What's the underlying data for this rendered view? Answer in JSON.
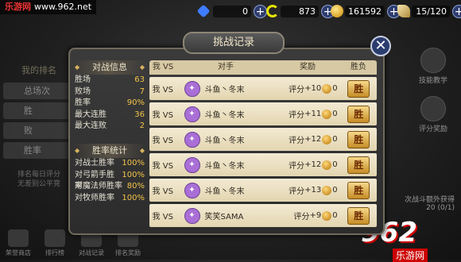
{
  "watermark": {
    "site": "乐游网",
    "url": "www.962.net"
  },
  "resources": [
    {
      "value": "0",
      "icon": "gem-icon",
      "color": "#3f7cff"
    },
    {
      "value": "873",
      "icon": "crescent-icon",
      "color": "#e6e600"
    },
    {
      "value": "161592",
      "icon": "gold-coin-icon",
      "color": "#f0b400"
    },
    {
      "value": "15/120",
      "icon": "stamina-icon",
      "color": "#e8d7a0"
    }
  ],
  "background_panel": {
    "title": "我的排名",
    "rows": [
      "总场次",
      "胜",
      "败",
      "胜率"
    ],
    "note": "排名每日评分\n无差别公平竞"
  },
  "bottom_nav": [
    "荣誉商店",
    "排行榜",
    "对战记录",
    "排名奖励"
  ],
  "right_side": [
    "技能教学",
    "评分奖励"
  ],
  "right_bottom": {
    "line1": "次战斗额外获得",
    "line2": "20 (0/1)"
  },
  "logo": {
    "big": "962",
    "sub": "乐游网"
  },
  "modal": {
    "title": "挑战记录",
    "close": "✕",
    "battle_info": {
      "heading": "对战信息",
      "items": [
        {
          "k": "胜场",
          "v": "63"
        },
        {
          "k": "败场",
          "v": "7"
        },
        {
          "k": "胜率",
          "v": "90%"
        },
        {
          "k": "最大连胜",
          "v": "36"
        },
        {
          "k": "最大连败",
          "v": "2"
        }
      ]
    },
    "win_rate": {
      "heading": "胜率统计",
      "items": [
        {
          "k": "对战士胜率",
          "v": "100%"
        },
        {
          "k": "对弓箭手胜率",
          "v": "100%"
        },
        {
          "k": "对魔法师胜率",
          "v": "80%"
        },
        {
          "k": "对牧师胜率",
          "v": "100%"
        }
      ]
    },
    "table": {
      "headers": {
        "me": "我",
        "vs": "VS",
        "opponent": "对手",
        "reward": "奖励",
        "result": "胜负"
      },
      "rows": [
        {
          "me": "我",
          "vs": "VS",
          "opponent": "斗鱼丶冬末",
          "score_label": "评分",
          "score": "+10",
          "coins": "0",
          "result": "胜"
        },
        {
          "me": "我",
          "vs": "VS",
          "opponent": "斗鱼丶冬末",
          "score_label": "评分",
          "score": "+11",
          "coins": "0",
          "result": "胜"
        },
        {
          "me": "我",
          "vs": "VS",
          "opponent": "斗鱼丶冬末",
          "score_label": "评分",
          "score": "+12",
          "coins": "0",
          "result": "胜"
        },
        {
          "me": "我",
          "vs": "VS",
          "opponent": "斗鱼丶冬末",
          "score_label": "评分",
          "score": "+12",
          "coins": "0",
          "result": "胜"
        },
        {
          "me": "我",
          "vs": "VS",
          "opponent": "斗鱼丶冬末",
          "score_label": "评分",
          "score": "+13",
          "coins": "0",
          "result": "胜"
        },
        {
          "me": "我",
          "vs": "VS",
          "opponent": "笑笑SAMA",
          "score_label": "评分",
          "score": "+9",
          "coins": "0",
          "result": "胜"
        }
      ]
    }
  }
}
